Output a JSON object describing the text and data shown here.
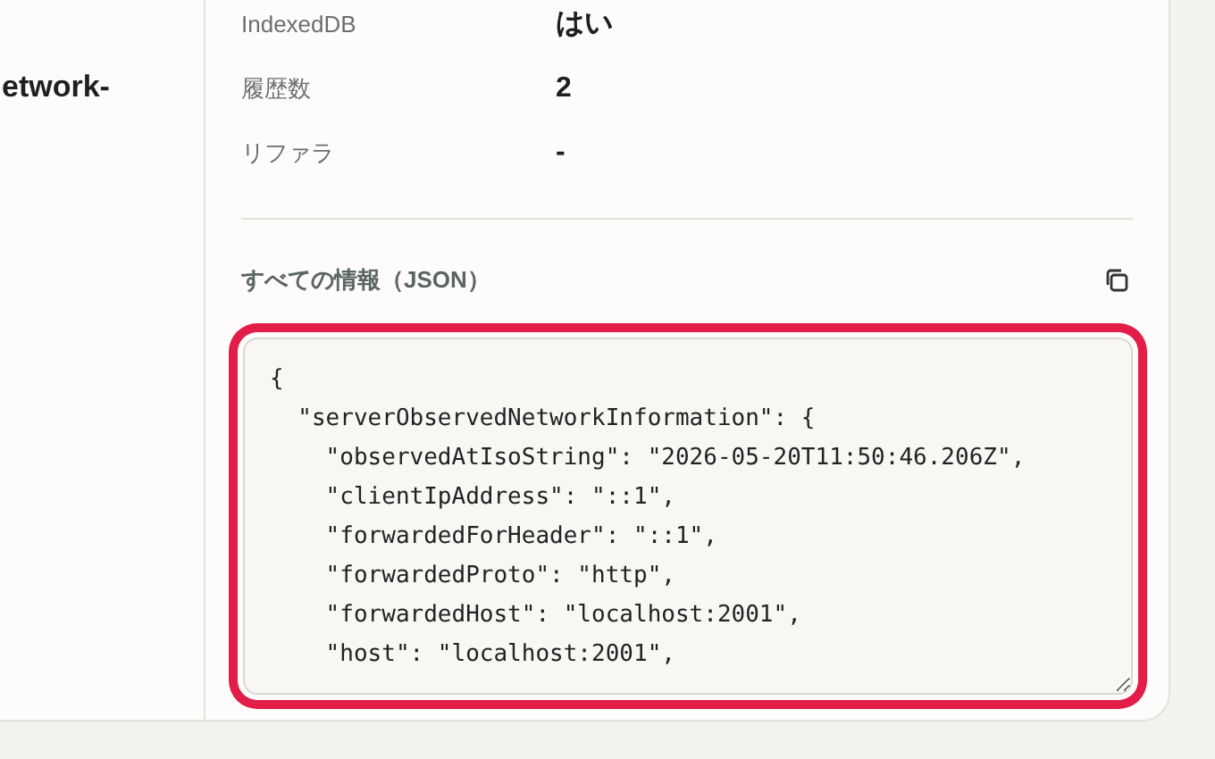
{
  "left_panel": {
    "text": "etwork-"
  },
  "details": [
    {
      "label": "IndexedDB",
      "value": "はい"
    },
    {
      "label": "履歴数",
      "value": "2"
    },
    {
      "label": "リファラ",
      "value": "-"
    }
  ],
  "all_info": {
    "heading": "すべての情報（JSON）",
    "focused": true,
    "lines": [
      "{",
      "  \"serverObservedNetworkInformation\": {",
      "    \"observedAtIsoString\": \"2026-05-20T11:50:46.206Z\",",
      "    \"clientIpAddress\": \"::1\",",
      "    \"forwardedForHeader\": \"::1\",",
      "    \"forwardedProto\": \"http\",",
      "    \"forwardedHost\": \"localhost:2001\",",
      "    \"host\": \"localhost:2001\","
    ]
  }
}
